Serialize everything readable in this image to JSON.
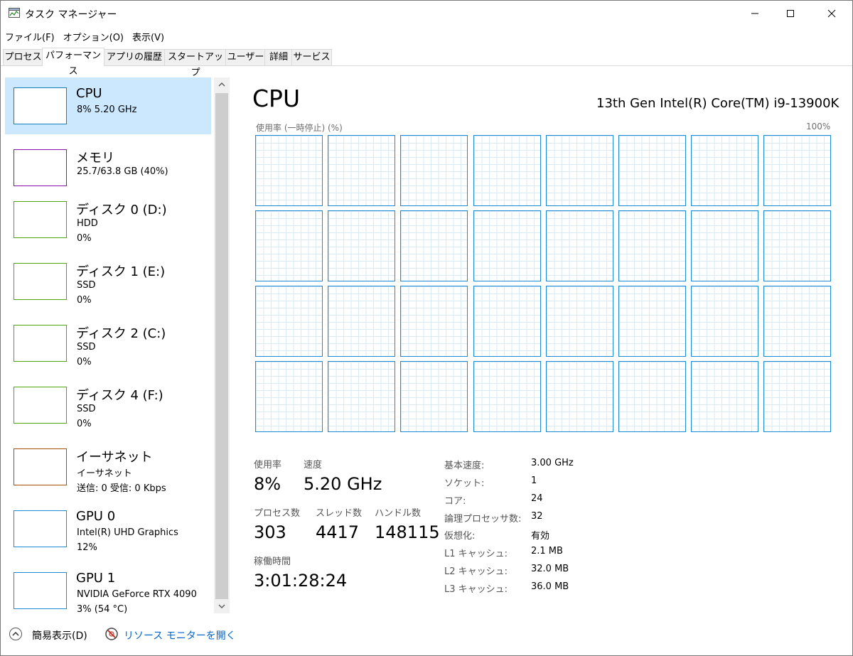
{
  "window": {
    "title": "タスク マネージャー"
  },
  "menu": [
    "ファイル(F)",
    "オプション(O)",
    "表示(V)"
  ],
  "tabs": [
    "プロセス",
    "パフォーマンス",
    "アプリの履歴",
    "スタートアップ",
    "ユーザー",
    "詳細",
    "サービス"
  ],
  "sidebar": {
    "items": [
      {
        "title": "CPU",
        "line2": "8%  5.20 GHz",
        "line3": "",
        "color": "#117dbb",
        "selected": true
      },
      {
        "title": "メモリ",
        "line2": "25.7/63.8 GB (40%)",
        "line3": "",
        "color": "#8b12ae"
      },
      {
        "title": "ディスク 0 (D:)",
        "line2": "HDD",
        "line3": "0%",
        "color": "#4da60c"
      },
      {
        "title": "ディスク 1 (E:)",
        "line2": "SSD",
        "line3": "0%",
        "color": "#4da60c"
      },
      {
        "title": "ディスク 2 (C:)",
        "line2": "SSD",
        "line3": "0%",
        "color": "#4da60c"
      },
      {
        "title": "ディスク 4 (F:)",
        "line2": "SSD",
        "line3": "0%",
        "color": "#4da60c"
      },
      {
        "title": "イーサネット",
        "line2": "イーサネット",
        "line3": "送信: 0  受信: 0 Kbps",
        "color": "#a74f01"
      },
      {
        "title": "GPU 0",
        "line2": "Intel(R) UHD Graphics",
        "line3": "12%",
        "color": "#1e8ad4"
      },
      {
        "title": "GPU 1",
        "line2": "NVIDIA GeForce RTX 4090",
        "line3": "3% (54 °C)",
        "color": "#1e8ad4"
      }
    ]
  },
  "main": {
    "title": "CPU",
    "model": "13th Gen Intel(R) Core(TM) i9-13900K",
    "graph_label": "使用率 (一時停止) (%)",
    "graph_max": "100%",
    "core_count": 32
  },
  "stats": {
    "usage_label": "使用率",
    "usage": "8%",
    "speed_label": "速度",
    "speed": "5.20 GHz",
    "processes_label": "プロセス数",
    "processes": "303",
    "threads_label": "スレッド数",
    "threads": "4417",
    "handles_label": "ハンドル数",
    "handles": "148115",
    "uptime_label": "稼働時間",
    "uptime": "3:01:28:24"
  },
  "info": [
    {
      "key": "基本速度:",
      "value": "3.00 GHz"
    },
    {
      "key": "ソケット:",
      "value": "1"
    },
    {
      "key": "コア:",
      "value": "24"
    },
    {
      "key": "論理プロセッサ数:",
      "value": "32"
    },
    {
      "key": "仮想化:",
      "value": "有効"
    },
    {
      "key": "L1 キャッシュ:",
      "value": "2.1 MB"
    },
    {
      "key": "L2 キャッシュ:",
      "value": "32.0 MB"
    },
    {
      "key": "L3 キャッシュ:",
      "value": "36.0 MB"
    }
  ],
  "footer": {
    "fewer_details": "簡易表示(D)",
    "resource_monitor": "リソース モニターを開く"
  }
}
